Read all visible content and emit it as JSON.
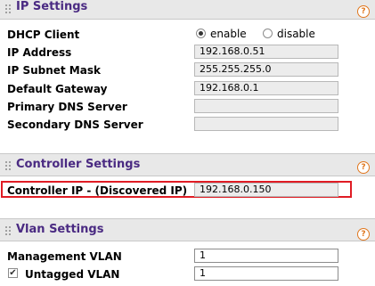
{
  "ip_settings": {
    "title": "IP Settings",
    "help": "?",
    "dhcp_label": "DHCP Client",
    "dhcp_enable": "enable",
    "dhcp_disable": "disable",
    "dhcp_selected": "enable",
    "ip_address_label": "IP Address",
    "ip_address": "192.168.0.51",
    "subnet_label": "IP Subnet Mask",
    "subnet": "255.255.255.0",
    "gateway_label": "Default Gateway",
    "gateway": "192.168.0.1",
    "primary_dns_label": "Primary DNS Server",
    "primary_dns": "",
    "secondary_dns_label": "Secondary DNS Server",
    "secondary_dns": ""
  },
  "controller_settings": {
    "title": "Controller Settings",
    "help": "?",
    "controller_ip_label": "Controller IP - (Discovered IP)",
    "controller_ip": "192.168.0.150"
  },
  "vlan_settings": {
    "title": "Vlan Settings",
    "help": "?",
    "management_label": "Management VLAN",
    "management": "1",
    "untagged_label": "Untagged VLAN",
    "untagged_checked": "✔",
    "untagged": "1"
  },
  "colors": {
    "header_title": "#4a2a82",
    "help_icon": "#e07820",
    "highlight": "#e01c24"
  }
}
